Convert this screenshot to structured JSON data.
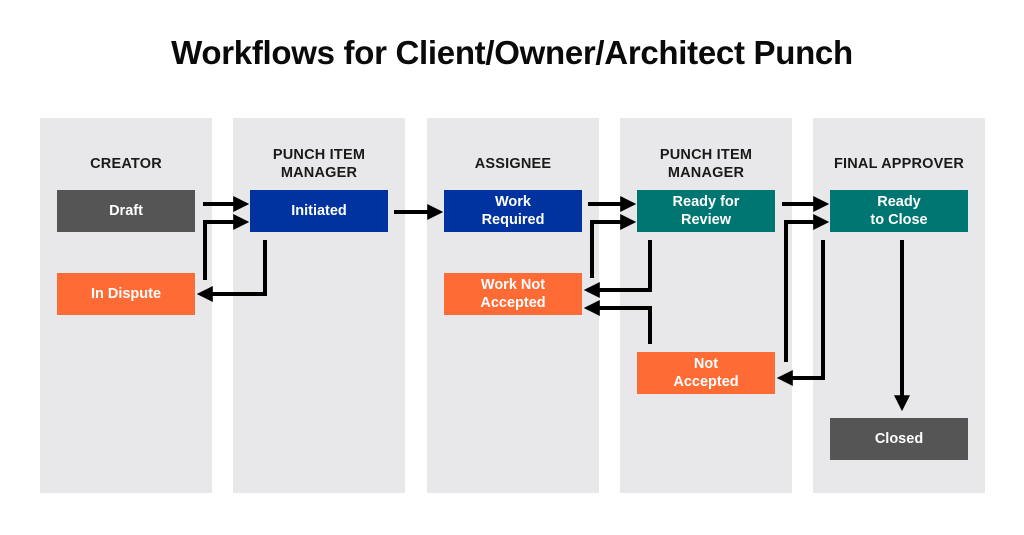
{
  "title": "Workflows for Client/Owner/Architect Punch",
  "lanes": [
    {
      "id": "creator",
      "label": "CREATOR"
    },
    {
      "id": "punch-item-manager-1",
      "label": "PUNCH ITEM MANAGER"
    },
    {
      "id": "assignee",
      "label": "ASSIGNEE"
    },
    {
      "id": "punch-item-manager-2",
      "label": "PUNCH ITEM MANAGER"
    },
    {
      "id": "final-approver",
      "label": "FINAL APPROVER"
    }
  ],
  "lane_titles": {
    "creator": "CREATOR",
    "pim1_line1": "PUNCH ITEM",
    "pim1_line2": "MANAGER",
    "assignee": "ASSIGNEE",
    "pim2_line1": "PUNCH ITEM",
    "pim2_line2": "MANAGER",
    "final_approver": "FINAL APPROVER"
  },
  "states": {
    "draft": {
      "label": "Draft",
      "lane": "creator",
      "color": "#555555"
    },
    "in_dispute": {
      "label": "In Dispute",
      "lane": "creator",
      "color": "#ff6b35"
    },
    "initiated": {
      "label": "Initiated",
      "lane": "punch-item-manager-1",
      "color": "#0033a0"
    },
    "work_required": {
      "label_line1": "Work",
      "label_line2": "Required",
      "lane": "assignee",
      "color": "#0033a0"
    },
    "work_not_accepted": {
      "label_line1": "Work Not",
      "label_line2": "Accepted",
      "lane": "assignee",
      "color": "#ff6b35"
    },
    "ready_for_review": {
      "label_line1": "Ready for",
      "label_line2": "Review",
      "lane": "punch-item-manager-2",
      "color": "#007672"
    },
    "not_accepted": {
      "label_line1": "Not",
      "label_line2": "Accepted",
      "lane": "punch-item-manager-2",
      "color": "#ff6b35"
    },
    "ready_to_close": {
      "label_line1": "Ready",
      "label_line2": "to Close",
      "lane": "final-approver",
      "color": "#007672"
    },
    "closed": {
      "label": "Closed",
      "lane": "final-approver",
      "color": "#555555"
    }
  },
  "transitions": [
    {
      "from": "Draft",
      "to": "Initiated"
    },
    {
      "from": "In Dispute",
      "to": "Initiated"
    },
    {
      "from": "Initiated",
      "to": "In Dispute"
    },
    {
      "from": "Initiated",
      "to": "Work Required"
    },
    {
      "from": "Work Required",
      "to": "Ready for Review"
    },
    {
      "from": "Work Not Accepted",
      "to": "Ready for Review"
    },
    {
      "from": "Ready for Review",
      "to": "Work Not Accepted"
    },
    {
      "from": "Not Accepted",
      "to": "Work Not Accepted"
    },
    {
      "from": "Ready for Review",
      "to": "Ready to Close"
    },
    {
      "from": "Not Accepted",
      "to": "Ready to Close"
    },
    {
      "from": "Ready to Close",
      "to": "Not Accepted"
    },
    {
      "from": "Ready to Close",
      "to": "Closed"
    }
  ]
}
